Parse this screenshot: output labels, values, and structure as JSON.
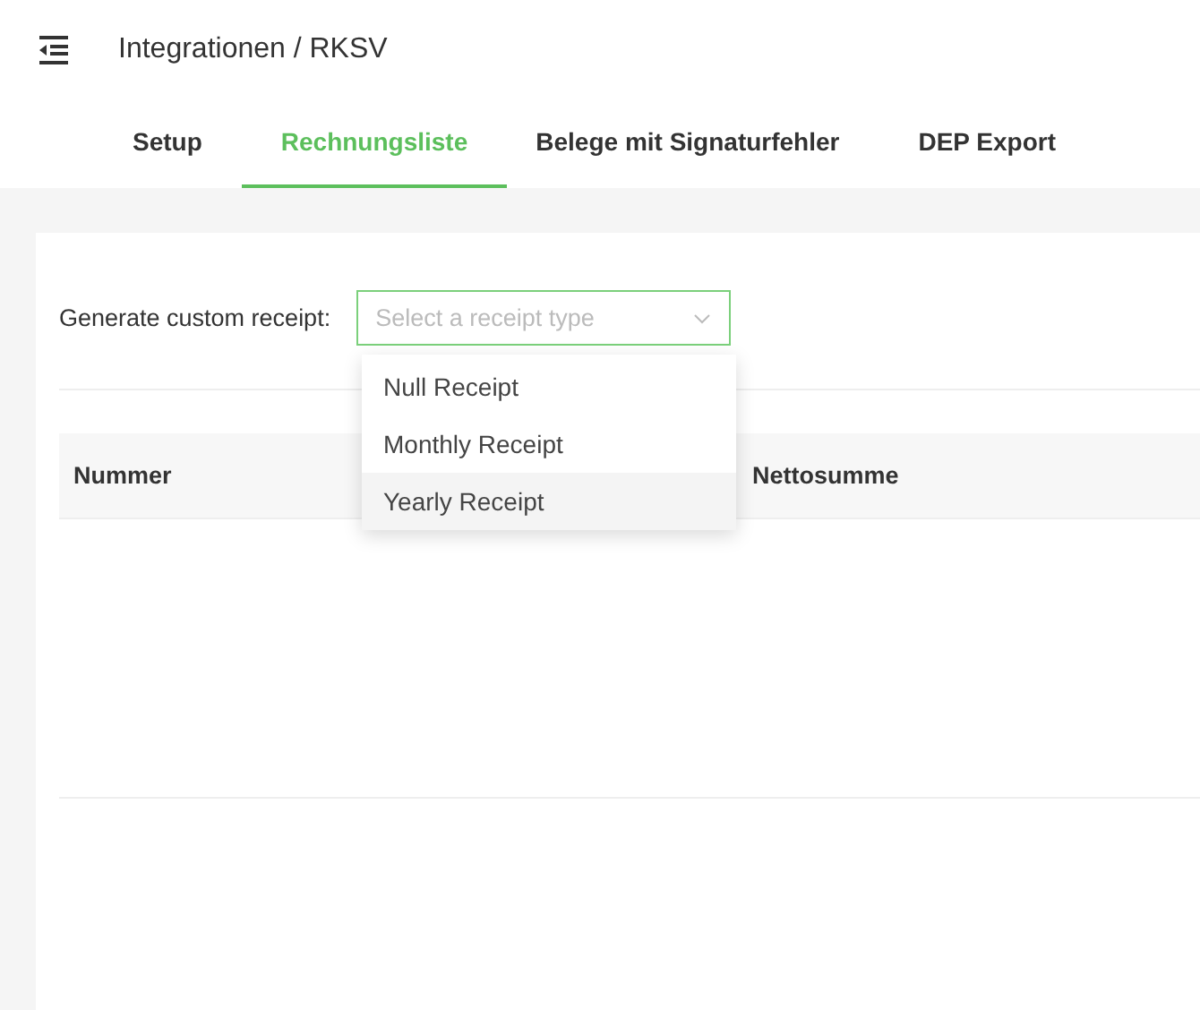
{
  "header": {
    "title": "Integrationen / RKSV"
  },
  "tabs": [
    {
      "label": "Setup",
      "selected": false
    },
    {
      "label": "Rechnungsliste",
      "selected": true
    },
    {
      "label": "Belege mit Signaturfehler",
      "selected": false
    },
    {
      "label": "DEP Export",
      "selected": false
    }
  ],
  "receipt_form": {
    "label": "Generate custom receipt:",
    "select": {
      "placeholder": "Select a receipt type",
      "expanded": true
    },
    "options": [
      {
        "label": "Null Receipt",
        "selected": false
      },
      {
        "label": "Monthly Receipt",
        "selected": false
      },
      {
        "label": "Yearly Receipt",
        "selected": true
      }
    ]
  },
  "table": {
    "columns": [
      "Nummer",
      "Nettosumme"
    ]
  }
}
